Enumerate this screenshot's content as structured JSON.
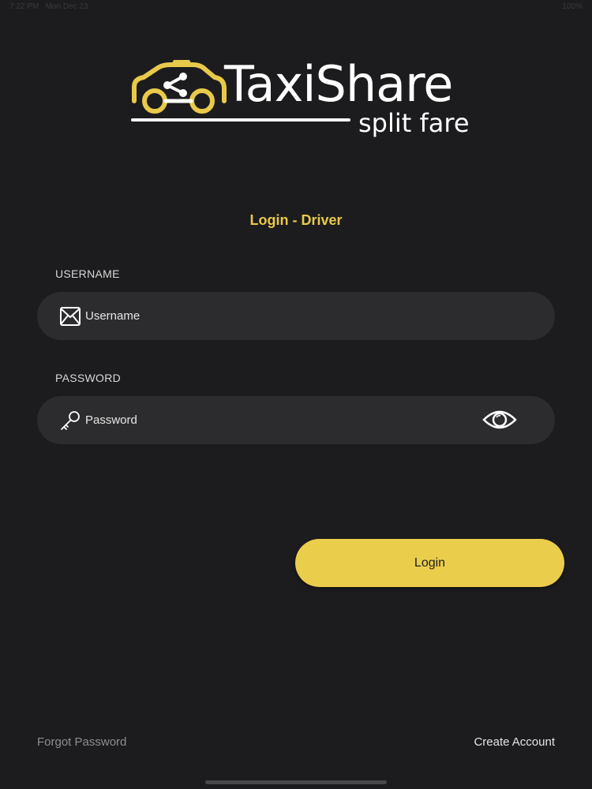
{
  "status_bar": {
    "time": "7:22 PM",
    "date": "Mon Dec 23",
    "battery": "100%"
  },
  "brand": {
    "name": "TaxiShare",
    "tagline": "split fare",
    "accent_color": "#E9C94A"
  },
  "screen": {
    "title": "Login - Driver"
  },
  "form": {
    "username": {
      "label": "USERNAME",
      "placeholder": "Username",
      "value": "",
      "icon": "envelope-icon"
    },
    "password": {
      "label": "PASSWORD",
      "placeholder": "Password",
      "value": "",
      "icon": "key-icon",
      "toggle_icon": "eye-icon"
    }
  },
  "actions": {
    "login_label": "Login",
    "login_color": "#EBCD4C"
  },
  "footer": {
    "forgot_password": "Forgot Password",
    "create_account": "Create Account"
  }
}
